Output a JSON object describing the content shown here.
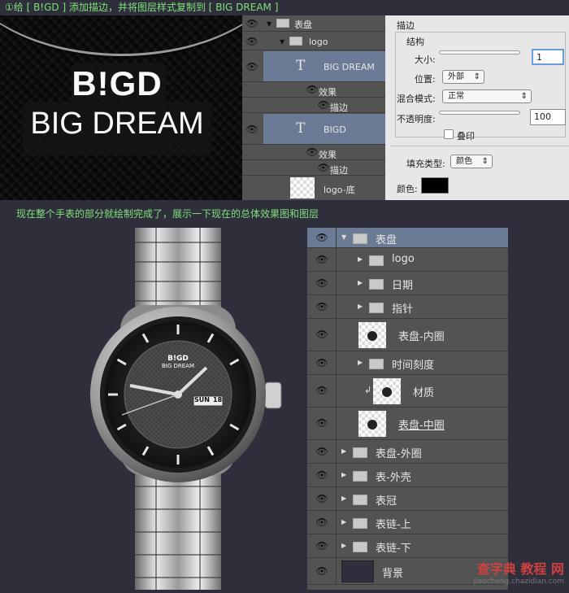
{
  "captions": {
    "top": "①给 [ B!GD ] 添加描边，并将图层样式复制到 [ BIG DREAM ]",
    "middle": "现在整个手表的部分就绘制完成了，展示一下现在的总体效果图和图层"
  },
  "logo_preview": {
    "line1": "B!GD",
    "line2": "BIG DREAM"
  },
  "layers_top": [
    {
      "label": "表盘",
      "type": "group",
      "expanded": true
    },
    {
      "label": "logo",
      "type": "group",
      "expanded": true
    },
    {
      "label": "BIG DREAM",
      "type": "text",
      "selected": true
    },
    {
      "label": "效果",
      "type": "effects"
    },
    {
      "label": "描边",
      "type": "effect"
    },
    {
      "label": "BIGD",
      "type": "text",
      "selected": true
    },
    {
      "label": "效果",
      "type": "effects"
    },
    {
      "label": "描边",
      "type": "effect"
    },
    {
      "label": "logo-底",
      "type": "shape"
    }
  ],
  "layer_style": {
    "title": "描边",
    "section": "结构",
    "size_label": "大小:",
    "size_value": "1",
    "position_label": "位置:",
    "position_value": "外部",
    "blend_label": "混合模式:",
    "blend_value": "正常",
    "opacity_label": "不透明度:",
    "opacity_value": "100",
    "overprint_label": "叠印",
    "fill_type_label": "填充类型:",
    "fill_type_value": "颜色",
    "color_label": "颜色:",
    "color_value": "#000000"
  },
  "watch": {
    "brand1": "B!GD",
    "brand2": "BIG DREAM",
    "day": "SUN",
    "date": "18"
  },
  "layers_bottom": [
    {
      "label": "表盘",
      "type": "group",
      "expanded": true,
      "selected": true
    },
    {
      "label": "logo",
      "type": "group",
      "indent": 1
    },
    {
      "label": "日期",
      "type": "group",
      "indent": 1
    },
    {
      "label": "指针",
      "type": "group",
      "indent": 1
    },
    {
      "label": "表盘-内圈",
      "type": "shape",
      "indent": 1
    },
    {
      "label": "时间刻度",
      "type": "group",
      "indent": 1
    },
    {
      "label": "材质",
      "type": "clipped",
      "indent": 1
    },
    {
      "label": "表盘-中圈",
      "type": "shape",
      "indent": 1
    },
    {
      "label": "表盘-外圈",
      "type": "group"
    },
    {
      "label": "表-外壳",
      "type": "group"
    },
    {
      "label": "表冠",
      "type": "group"
    },
    {
      "label": "表链-上",
      "type": "group"
    },
    {
      "label": "表链-下",
      "type": "group"
    },
    {
      "label": "背景",
      "type": "fill"
    }
  ],
  "watermark": {
    "main": "查字典 教程 网",
    "sub": "jiaocheng.chazidian.com"
  },
  "colors": {
    "caption": "#7fe07a",
    "selected_layer": "#6b7b96",
    "panel": "#535353",
    "background": "#2f2f3b"
  }
}
